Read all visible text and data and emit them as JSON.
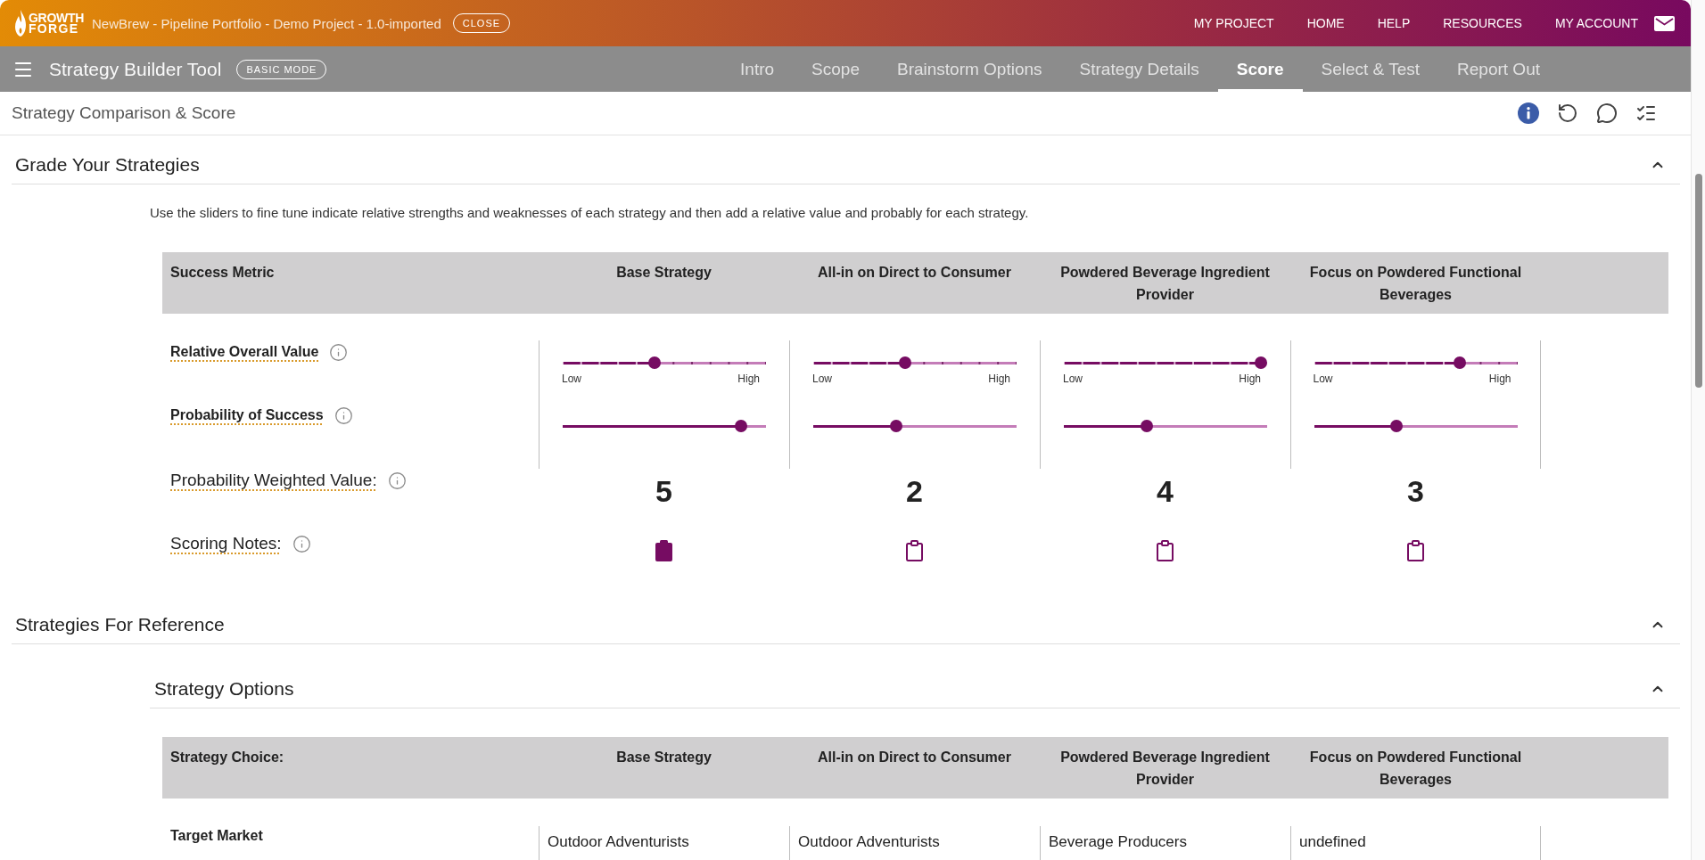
{
  "top_bar": {
    "logo": {
      "line_1": "GROWTH",
      "line_2": "FORGE"
    },
    "project_title": "NewBrew - Pipeline Portfolio - Demo Project - 1.0-imported",
    "close_button": "CLOSE",
    "nav_links": [
      "MY PROJECT",
      "HOME",
      "HELP",
      "RESOURCES",
      "MY ACCOUNT"
    ]
  },
  "tool_bar": {
    "title": "Strategy Builder Tool",
    "mode_badge": "BASIC MODE",
    "tabs": [
      {
        "label": "Intro",
        "selected": false
      },
      {
        "label": "Scope",
        "selected": false
      },
      {
        "label": "Brainstorm Options",
        "selected": false
      },
      {
        "label": "Strategy Details",
        "selected": false
      },
      {
        "label": "Score",
        "selected": true
      },
      {
        "label": "Select & Test",
        "selected": false
      },
      {
        "label": "Report Out",
        "selected": false
      }
    ]
  },
  "page_header": {
    "title": "Strategy Comparison & Score"
  },
  "grade_section": {
    "title": "Grade Your Strategies",
    "expanded": true,
    "instructions": "Use the sliders to fine tune indicate relative strengths and weaknesses of each strategy and then add a relative value and probably for each strategy.",
    "table": {
      "header_label": "Success Metric",
      "columns": [
        "Base Strategy",
        "All-in on Direct to Consumer",
        "Powdered Beverage Ingredient Provider",
        "Focus on Powdered Functional Beverages"
      ],
      "rows": [
        {
          "kind": "slider",
          "label": "Relative Overall Value",
          "stepped": true,
          "cells": [
            {
              "level": 0.45,
              "min_label": "Low",
              "max_label": "High"
            },
            {
              "level": 0.45,
              "min_label": "Low",
              "max_label": "High"
            },
            {
              "level": 1,
              "min_label": "Low",
              "max_label": "High"
            },
            {
              "level": 0.73,
              "min_label": "Low",
              "max_label": "High"
            }
          ]
        },
        {
          "kind": "slider",
          "label": "Probability of Success",
          "stepped": false,
          "cells": [
            {
              "level": 0.9
            },
            {
              "level": 0.4
            },
            {
              "level": 0.4
            },
            {
              "level": 0.4
            }
          ]
        },
        {
          "kind": "score",
          "label": "Probability Weighted Value:",
          "cells": [
            "5",
            "2",
            "4",
            "3"
          ]
        },
        {
          "kind": "notes",
          "label": "Scoring Notes:",
          "cells": [
            {
              "has_notes": true
            },
            {
              "has_notes": false
            },
            {
              "has_notes": false
            },
            {
              "has_notes": false
            }
          ]
        }
      ]
    }
  },
  "reference_section": {
    "title": "Strategies For Reference",
    "expanded": true,
    "subsection": {
      "title": "Strategy Options",
      "expanded": true,
      "table": {
        "header_label": "Strategy Choice:",
        "columns": [
          "Base Strategy",
          "All-in on Direct to Consumer",
          "Powdered Beverage Ingredient Provider",
          "Focus on Powdered Functional Beverages"
        ],
        "rows": [
          {
            "label": "Target Market",
            "cells": [
              "Outdoor Adventurists",
              "Outdoor Adventurists",
              "Beverage Producers",
              "undefined"
            ]
          }
        ]
      }
    }
  }
}
